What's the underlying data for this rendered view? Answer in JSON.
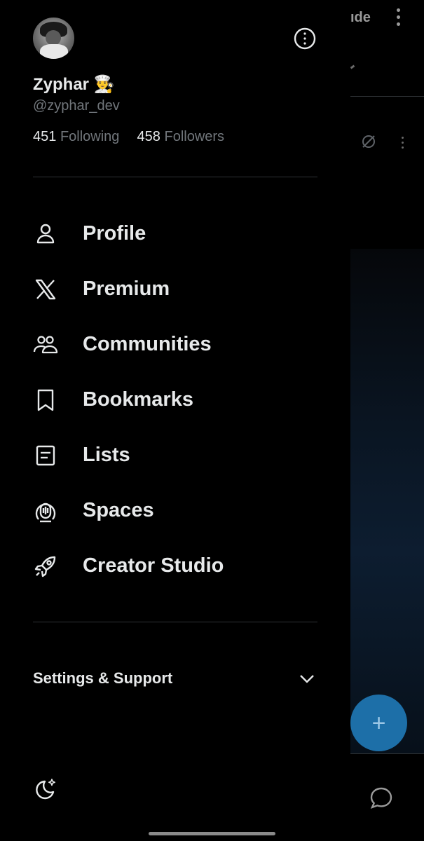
{
  "background": {
    "title_fragment": "ıde",
    "fab_symbol": "+",
    "fab_color": "#1d6fa8"
  },
  "profile": {
    "name": "Zyphar 👨‍🍳",
    "handle": "@zyphar_dev",
    "following_count": "451",
    "following_label": "Following",
    "followers_count": "458",
    "followers_label": "Followers",
    "more_icon": "info-circle-icon"
  },
  "menu": {
    "items": [
      {
        "label": "Profile",
        "icon": "person-icon"
      },
      {
        "label": "Premium",
        "icon": "x-logo-icon"
      },
      {
        "label": "Communities",
        "icon": "communities-icon"
      },
      {
        "label": "Bookmarks",
        "icon": "bookmark-icon"
      },
      {
        "label": "Lists",
        "icon": "list-icon"
      },
      {
        "label": "Spaces",
        "icon": "spaces-icon"
      },
      {
        "label": "Creator Studio",
        "icon": "rocket-icon"
      }
    ]
  },
  "settings": {
    "label": "Settings & Support",
    "icon": "chevron-down-icon"
  },
  "footer": {
    "theme_icon": "moon-icon"
  },
  "colors": {
    "background": "#000000",
    "text_primary": "#e7e9ea",
    "text_secondary": "#71767b",
    "divider": "#2f3336"
  }
}
